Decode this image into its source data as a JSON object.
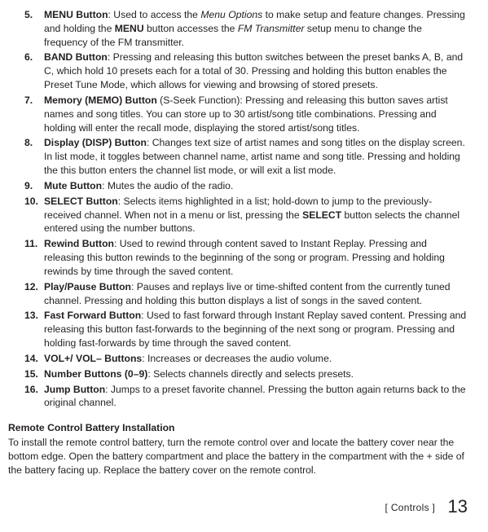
{
  "list": [
    {
      "num": "5.",
      "title": "MENU Button",
      "pre": ": Used to access the ",
      "ital1": "Menu Options",
      "mid": " to make setup and feature changes. Pressing and holding the ",
      "bold1": "MENU",
      "mid2": " button accesses the ",
      "ital2": "FM Transmitter",
      "rest": " setup menu to change the frequency of the FM transmitter."
    },
    {
      "num": "6.",
      "title": "BAND Button",
      "rest": ": Pressing and releasing this button switches between the preset banks A, B, and C, which hold 10 presets each for a total of 30. Pressing and holding this button enables the Preset Tune Mode, which allows for viewing and browsing of stored presets."
    },
    {
      "num": "7.",
      "title": "Memory (MEMO) Button",
      "rest": " (S-Seek Function): Pressing and releasing this button saves artist names and song titles. You can store up to 30 artist/song title combinations. Pressing and holding will enter the recall mode, displaying the stored artist/song titles."
    },
    {
      "num": "8.",
      "title": "Display (DISP) Button",
      "rest": ": Changes text size of artist names and song titles on the display screen. In list mode, it toggles between channel name, artist name and song title. Pressing and holding the this button enters the channel list mode, or will exit a list mode."
    },
    {
      "num": "9.",
      "title": "Mute Button",
      "rest": ": Mutes the audio of the radio."
    },
    {
      "num": "10.",
      "title": "SELECT Button",
      "pre": ": Selects items highlighted in a list; hold-down to jump to the previously-received channel. When not in a menu or list, pressing the ",
      "bold1": "SELECT",
      "rest": " button selects the channel entered using the number buttons."
    },
    {
      "num": "11.",
      "title": "Rewind Button",
      "rest": ": Used to rewind through content saved to Instant Replay. Pressing and releasing this button rewinds to the beginning of the song or program. Pressing and holding rewinds by time through the saved content."
    },
    {
      "num": "12.",
      "title": "Play/Pause Button",
      "rest": ": Pauses and replays live or time-shifted content from the currently tuned channel. Pressing and holding this button displays a list of songs in the saved content."
    },
    {
      "num": "13.",
      "title": "Fast Forward Button",
      "rest": ": Used to fast forward through Instant Replay saved content. Pressing and releasing this button fast-forwards to the beginning of the next song or program. Pressing and holding fast-forwards by time through the saved content."
    },
    {
      "num": "14.",
      "title": "VOL+/ VOL– Buttons",
      "rest": ": Increases or decreases the audio volume."
    },
    {
      "num": "15.",
      "title": "Number Buttons (0–9)",
      "rest": ": Selects channels directly and selects presets."
    },
    {
      "num": "16.",
      "title": "Jump Button",
      "rest": ": Jumps to a preset favorite channel. Pressing the button again returns back to the original channel."
    }
  ],
  "section": {
    "title": "Remote Control Battery Installation",
    "body": "To install the remote control battery, turn the remote control over and locate the battery cover near the bottom edge. Open the battery compartment and place the battery in the compartment with the + side of the battery facing up. Replace the battery cover on the remote control."
  },
  "footer": {
    "label": "[ Controls ]",
    "page": "13"
  }
}
